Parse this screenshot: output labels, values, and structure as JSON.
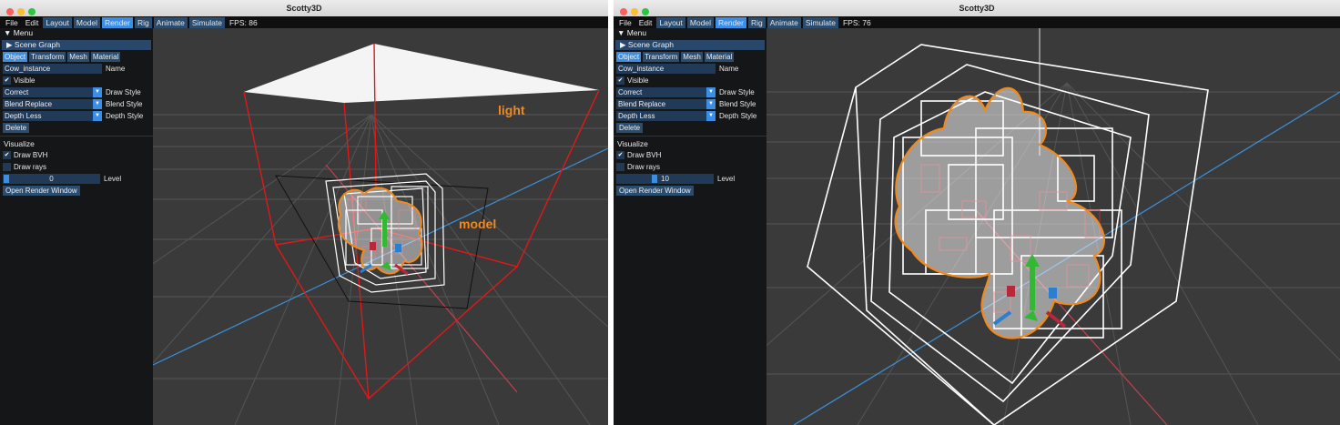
{
  "windows": [
    {
      "title": "Scotty3D",
      "menubar": {
        "items": [
          "File",
          "Edit"
        ],
        "modes": [
          "Layout",
          "Model",
          "Render",
          "Rig",
          "Animate",
          "Simulate"
        ],
        "active_mode": "Render",
        "fps": "FPS: 86"
      },
      "panel": {
        "menu_header": "Menu",
        "scene_graph": "Scene Graph",
        "tabs": [
          "Object",
          "Transform",
          "Mesh",
          "Material"
        ],
        "active_tab": "Object",
        "name_value": "Cow_instance",
        "name_label": "Name",
        "visible_label": "Visible",
        "draw_style_value": "Correct",
        "draw_style_label": "Draw Style",
        "blend_style_value": "Blend Replace",
        "blend_style_label": "Blend Style",
        "depth_style_value": "Depth Less",
        "depth_style_label": "Depth Style",
        "delete_label": "Delete",
        "visualize_label": "Visualize",
        "draw_bvh_label": "Draw BVH",
        "draw_bvh_checked": true,
        "draw_rays_label": "Draw rays",
        "draw_rays_checked": false,
        "level_value": "0",
        "level_label": "Level",
        "level_fraction": 0.0,
        "open_render_label": "Open Render Window"
      },
      "annotations": {
        "light": "light",
        "model": "model"
      }
    },
    {
      "title": "Scotty3D",
      "menubar": {
        "items": [
          "File",
          "Edit"
        ],
        "modes": [
          "Layout",
          "Model",
          "Render",
          "Rig",
          "Animate",
          "Simulate"
        ],
        "active_mode": "Render",
        "fps": "FPS: 76"
      },
      "panel": {
        "menu_header": "Menu",
        "scene_graph": "Scene Graph",
        "tabs": [
          "Object",
          "Transform",
          "Mesh",
          "Material"
        ],
        "active_tab": "Object",
        "name_value": "Cow_instance",
        "name_label": "Name",
        "visible_label": "Visible",
        "draw_style_value": "Correct",
        "draw_style_label": "Draw Style",
        "blend_style_value": "Blend Replace",
        "blend_style_label": "Blend Style",
        "depth_style_value": "Depth Less",
        "depth_style_label": "Depth Style",
        "delete_label": "Delete",
        "visualize_label": "Visualize",
        "draw_bvh_label": "Draw BVH",
        "draw_bvh_checked": true,
        "draw_rays_label": "Draw rays",
        "draw_rays_checked": false,
        "level_value": "10",
        "level_label": "Level",
        "level_fraction": 0.38,
        "open_render_label": "Open Render Window"
      }
    }
  ],
  "colors": {
    "accent": "#3a8ee6",
    "widget": "#213a58",
    "tab": "#2a4c6e",
    "panel": "#151617",
    "viewport": "#3a3a3a",
    "annotation": "#f08a1e",
    "bvh_line": "#ffffff",
    "bvh_leaf": "#d0263a",
    "light_frame": "#e01818",
    "axis_x": "#e0505a",
    "axis_z": "#3c8fd8"
  }
}
